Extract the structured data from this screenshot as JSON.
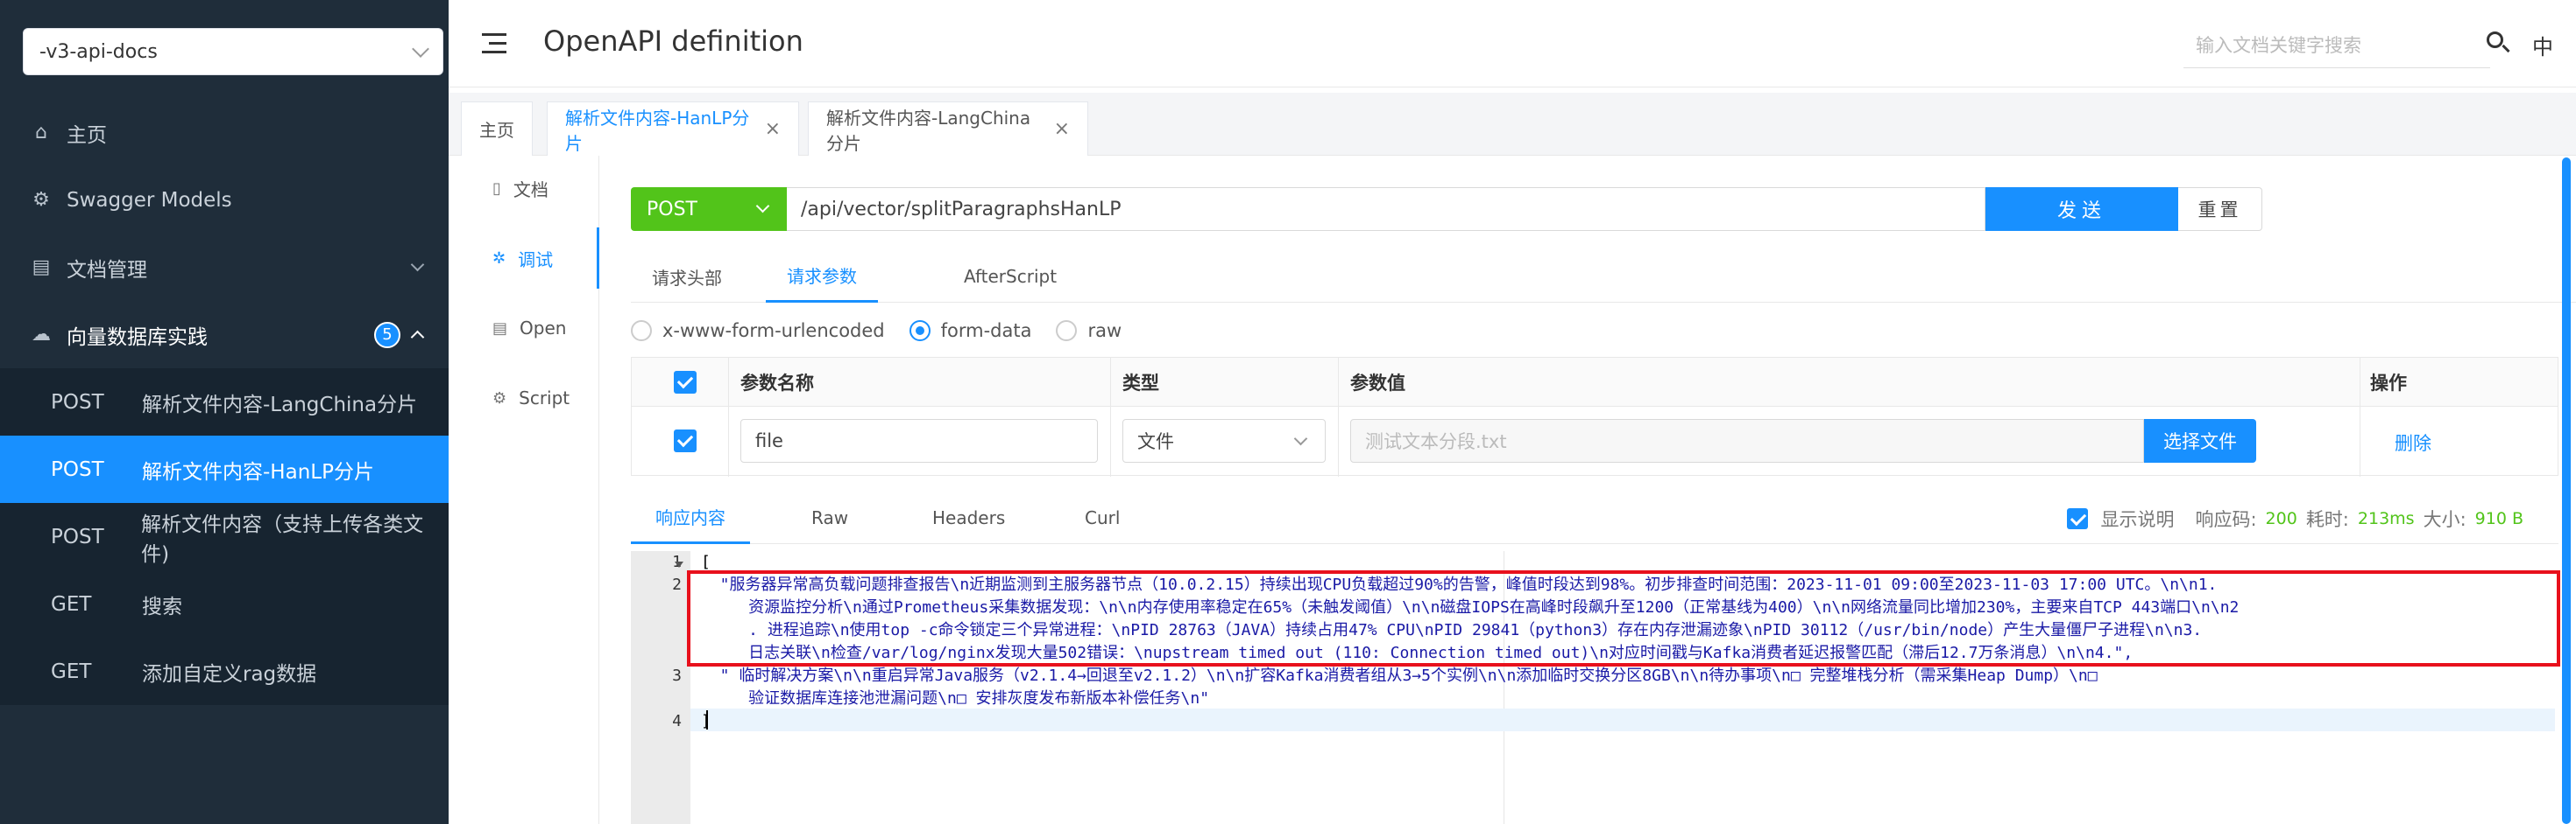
{
  "sidebar": {
    "group_select": "-v3-api-docs",
    "menu": [
      {
        "label": "主页",
        "icon": "home-icon"
      },
      {
        "label": "Swagger Models",
        "icon": "gear-icon"
      },
      {
        "label": "文档管理",
        "icon": "document-icon"
      },
      {
        "label": "向量数据库实践",
        "icon": "cloud-icon",
        "badge": "5"
      }
    ],
    "sub_items": [
      {
        "method": "POST",
        "label": "解析文件内容-LangChina分片"
      },
      {
        "method": "POST",
        "label": "解析文件内容-HanLP分片"
      },
      {
        "method": "POST",
        "label": "解析文件内容（支持上传各类文件)"
      },
      {
        "method": "GET",
        "label": "搜索"
      },
      {
        "method": "GET",
        "label": "添加自定义rag数据"
      }
    ]
  },
  "header": {
    "title": "OpenAPI definition",
    "search_placeholder": "输入文档关键字搜索",
    "lang": "中"
  },
  "tabs": [
    {
      "label": "主页"
    },
    {
      "label": "解析文件内容-HanLP分片",
      "close": "×"
    },
    {
      "label": "解析文件内容-LangChina分片",
      "close": "×"
    }
  ],
  "inner_nav": [
    {
      "label": "文档"
    },
    {
      "label": "调试"
    },
    {
      "label": "Open"
    },
    {
      "label": "Script"
    }
  ],
  "request": {
    "method": "POST",
    "url": "/api/vector/splitParagraphsHanLP",
    "send": "发送",
    "reset": "重置"
  },
  "sub_tabs": [
    "请求头部",
    "请求参数",
    "AfterScript"
  ],
  "radios": [
    "x-www-form-urlencoded",
    "form-data",
    "raw"
  ],
  "params_table": {
    "headers": {
      "name": "参数名称",
      "type": "类型",
      "value": "参数值",
      "op": "操作"
    },
    "row": {
      "name": "file",
      "type": "文件",
      "value_placeholder": "测试文本分段.txt",
      "choose": "选择文件",
      "delete": "删除"
    }
  },
  "response": {
    "tabs": [
      "响应内容",
      "Raw",
      "Headers",
      "Curl"
    ],
    "show_desc": "显示说明",
    "code_label": "响应码:",
    "code": "200",
    "time_label": "耗时:",
    "time": "213ms",
    "size_label": "大小:",
    "size": "910 B"
  },
  "editor": {
    "line_numbers": [
      "1",
      "2",
      "3",
      "4"
    ],
    "lines": [
      "[",
      "  \"服务器异常高负载问题排查报告\\n近期监测到主服务器节点（10.0.2.15）持续出现CPU负载超过90%的告警，峰值时段达到98%。初步排查时间范围：2023-11-01 09:00至2023-11-03 17:00 UTC。\\n\\n1.",
      "     资源监控分析\\n通过Prometheus采集数据发现：\\n\\n内存使用率稳定在65%（未触发阈值）\\n\\n磁盘IOPS在高峰时段飙升至1200（正常基线为400）\\n\\n网络流量同比增加230%，主要来自TCP 443端口\\n\\n2",
      "     . 进程追踪\\n使用top -c命令锁定三个异常进程：\\nPID 28763（JAVA）持续占用47% CPU\\nPID 29841（python3）存在内存泄漏迹象\\nPID 30112（/usr/bin/node）产生大量僵尸子进程\\n\\n3.",
      "     日志关联\\n检查/var/log/nginx发现大量502错误：\\nupstream timed out (110: Connection timed out)\\n对应时间戳与Kafka消费者延迟报警匹配（滞后12.7万条消息）\\n\\n4.\",",
      "  \" 临时解决方案\\n\\n重启异常Java服务（v2.1.4→回退至v2.1.2）\\n\\n扩容Kafka消费者组从3→5个实例\\n\\n添加临时交换分区8GB\\n\\n待办事项\\n□ 完整堆栈分析（需采集Heap Dump）\\n□",
      "     验证数据库连接池泄漏问题\\n□ 安排灰度发布新版本补偿任务\\n\"",
      "]"
    ]
  },
  "colors": {
    "sidebar_bg": "#1f2d3a",
    "accent": "#1890ff",
    "method_post": "#52c41a",
    "highlight": "#e8101c"
  }
}
